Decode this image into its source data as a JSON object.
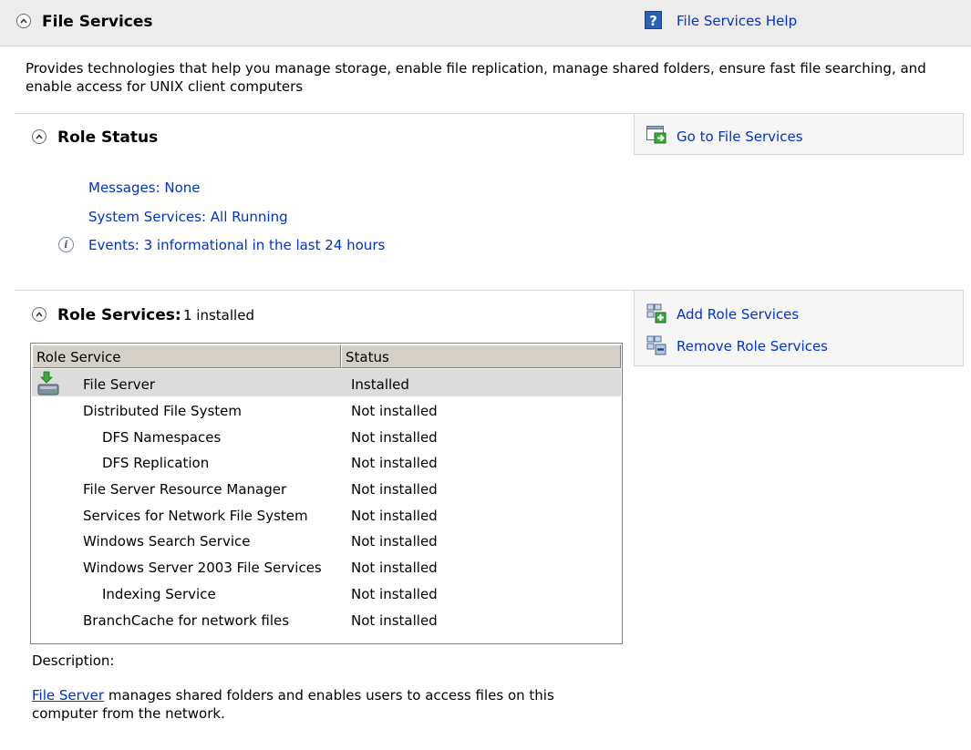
{
  "header": {
    "title": "File Services",
    "help_label": "File Services Help",
    "help_icon": "help-icon"
  },
  "description": "Provides technologies that help you manage storage, enable file replication, manage shared folders, ensure fast file searching, and enable access for UNIX client computers",
  "role_status": {
    "title": "Role Status",
    "goto_label": "Go to File Services",
    "messages": "Messages: None",
    "services": "System Services: All Running",
    "events": "Events: 3 informational in the last 24 hours"
  },
  "role_services": {
    "title": "Role Services:",
    "count": "1 installed",
    "add_label": "Add Role Services",
    "remove_label": "Remove Role Services",
    "columns": [
      "Role Service",
      "Status"
    ],
    "rows": [
      {
        "name": "File Server",
        "status": "Installed"
      },
      {
        "name": "Distributed File System",
        "status": "Not installed"
      },
      {
        "name": "DFS Namespaces",
        "status": "Not installed"
      },
      {
        "name": "DFS Replication",
        "status": "Not installed"
      },
      {
        "name": "File Server Resource Manager",
        "status": "Not installed"
      },
      {
        "name": "Services for Network File System",
        "status": "Not installed"
      },
      {
        "name": "Windows Search Service",
        "status": "Not installed"
      },
      {
        "name": "Windows Server 2003 File Services",
        "status": "Not installed"
      },
      {
        "name": "Indexing Service",
        "status": "Not installed"
      },
      {
        "name": "BranchCache for network files",
        "status": "Not installed"
      }
    ],
    "description_label": "Description:",
    "description_link": "File Server",
    "description_text": " manages shared folders and enables users to access files on this computer from the network."
  }
}
